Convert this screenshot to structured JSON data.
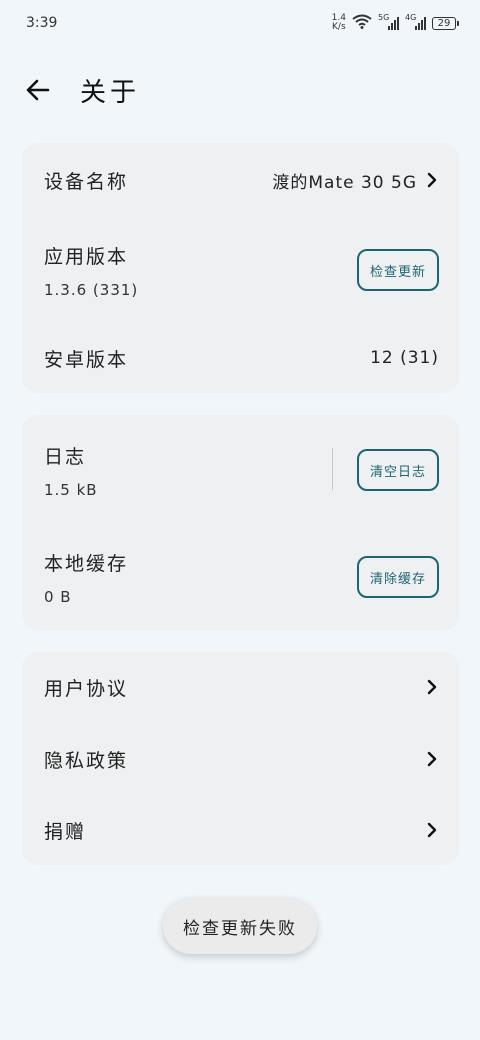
{
  "status_bar": {
    "time": "3:39",
    "net_speed_value": "1.4",
    "net_speed_unit": "K/s",
    "sim1_label": "5G",
    "sim2_label": "4G",
    "battery": "29"
  },
  "header": {
    "title": "关于"
  },
  "device_card": {
    "device_name_label": "设备名称",
    "device_name_value": "渡的Mate 30 5G",
    "app_version_label": "应用版本",
    "app_version_value": "1.3.6 (331)",
    "check_update_button": "检查更新",
    "android_version_label": "安卓版本",
    "android_version_value": "12 (31)"
  },
  "storage_card": {
    "log_label": "日志",
    "log_size": "1.5 kB",
    "clear_log_button": "清空日志",
    "cache_label": "本地缓存",
    "cache_size": "0 B",
    "clear_cache_button": "清除缓存"
  },
  "links_card": {
    "items": [
      {
        "label": "用户协议"
      },
      {
        "label": "隐私政策"
      },
      {
        "label": "捐赠"
      }
    ]
  },
  "toast": {
    "message": "检查更新失败"
  },
  "colors": {
    "background": "#f1f6fb",
    "card": "#eef0f1",
    "accent": "#1f6475"
  }
}
